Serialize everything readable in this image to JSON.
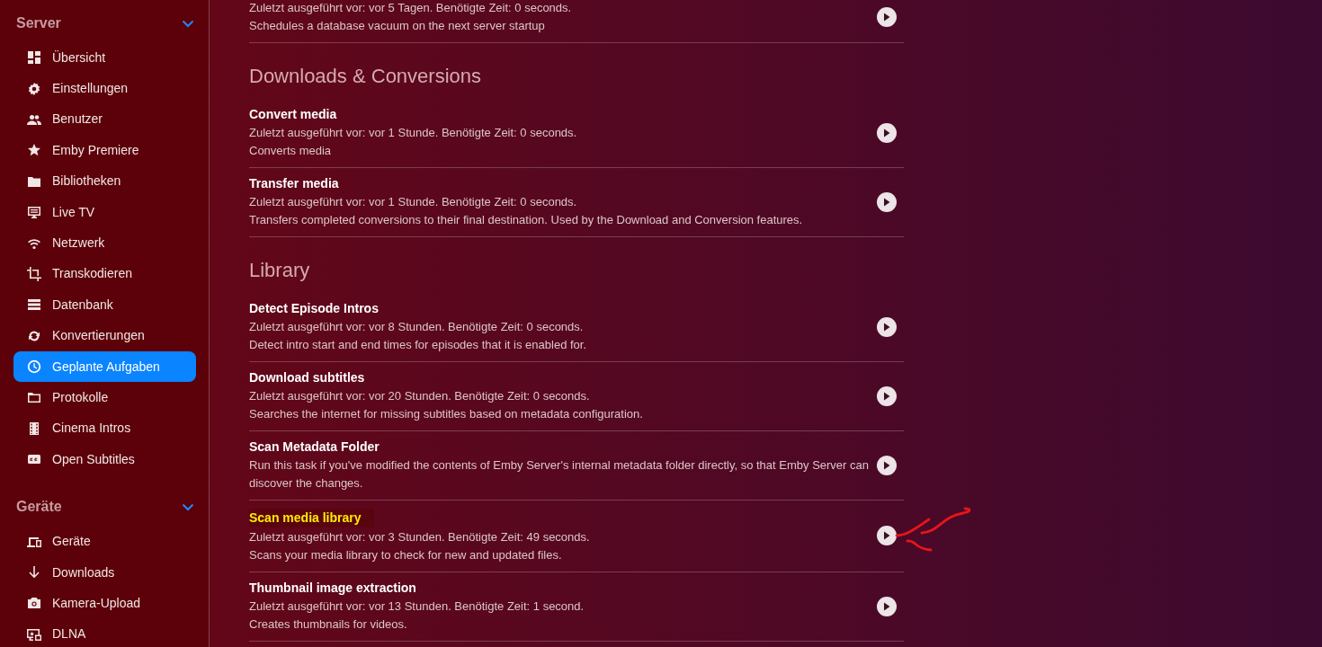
{
  "sidebar": {
    "sections": [
      {
        "title": "Server",
        "expanded": true,
        "items": [
          {
            "label": "Übersicht",
            "selected": false
          },
          {
            "label": "Einstellungen",
            "selected": false
          },
          {
            "label": "Benutzer",
            "selected": false
          },
          {
            "label": "Emby Premiere",
            "selected": false
          },
          {
            "label": "Bibliotheken",
            "selected": false
          },
          {
            "label": "Live TV",
            "selected": false
          },
          {
            "label": "Netzwerk",
            "selected": false
          },
          {
            "label": "Transkodieren",
            "selected": false
          },
          {
            "label": "Datenbank",
            "selected": false
          },
          {
            "label": "Konvertierungen",
            "selected": false
          },
          {
            "label": "Geplante Aufgaben",
            "selected": true
          },
          {
            "label": "Protokolle",
            "selected": false
          },
          {
            "label": "Cinema Intros",
            "selected": false
          },
          {
            "label": "Open Subtitles",
            "selected": false
          }
        ]
      },
      {
        "title": "Geräte",
        "expanded": true,
        "items": [
          {
            "label": "Geräte",
            "selected": false
          },
          {
            "label": "Downloads",
            "selected": false
          },
          {
            "label": "Kamera-Upload",
            "selected": false
          },
          {
            "label": "DLNA",
            "selected": false
          }
        ]
      }
    ]
  },
  "task_groups": [
    {
      "tasks": [
        {
          "last_run": "Zuletzt ausgeführt vor: vor 5 Tagen. Benötigte Zeit: 0 seconds.",
          "description": "Schedules a database vacuum on the next server startup",
          "annotated": false
        }
      ]
    },
    {
      "heading": "Downloads & Conversions",
      "tasks": [
        {
          "name": "Convert media",
          "last_run": "Zuletzt ausgeführt vor: vor 1 Stunde. Benötigte Zeit: 0 seconds.",
          "description": "Converts media",
          "highlighted": false,
          "annotated": false
        },
        {
          "name": "Transfer media",
          "last_run": "Zuletzt ausgeführt vor: vor 1 Stunde. Benötigte Zeit: 0 seconds.",
          "description": "Transfers completed conversions to their final destination. Used by the Download and Conversion features.",
          "highlighted": false,
          "annotated": false
        }
      ]
    },
    {
      "heading": "Library",
      "tasks": [
        {
          "name": "Detect Episode Intros",
          "last_run": "Zuletzt ausgeführt vor: vor 8 Stunden. Benötigte Zeit: 0 seconds.",
          "description": "Detect intro start and end times for episodes that it is enabled for.",
          "highlighted": false,
          "annotated": false
        },
        {
          "name": "Download subtitles",
          "last_run": "Zuletzt ausgeführt vor: vor 20 Stunden. Benötigte Zeit: 0 seconds.",
          "description": "Searches the internet for missing subtitles based on metadata configuration.",
          "highlighted": false,
          "annotated": false
        },
        {
          "name": "Scan Metadata Folder",
          "description": "Run this task if you've modified the contents of Emby Server's internal metadata folder directly, so that Emby Server can discover the changes.",
          "highlighted": false,
          "annotated": false
        },
        {
          "name": "Scan media library",
          "last_run": "Zuletzt ausgeführt vor: vor 3 Stunden. Benötigte Zeit: 49 seconds.",
          "description": "Scans your media library to check for new and updated files.",
          "highlighted": true,
          "annotated": true
        },
        {
          "name": "Thumbnail image extraction",
          "last_run": "Zuletzt ausgeführt vor: vor 13 Stunden. Benötigte Zeit: 1 second.",
          "description": "Creates thumbnails for videos.",
          "highlighted": false,
          "annotated": false
        }
      ]
    }
  ]
}
